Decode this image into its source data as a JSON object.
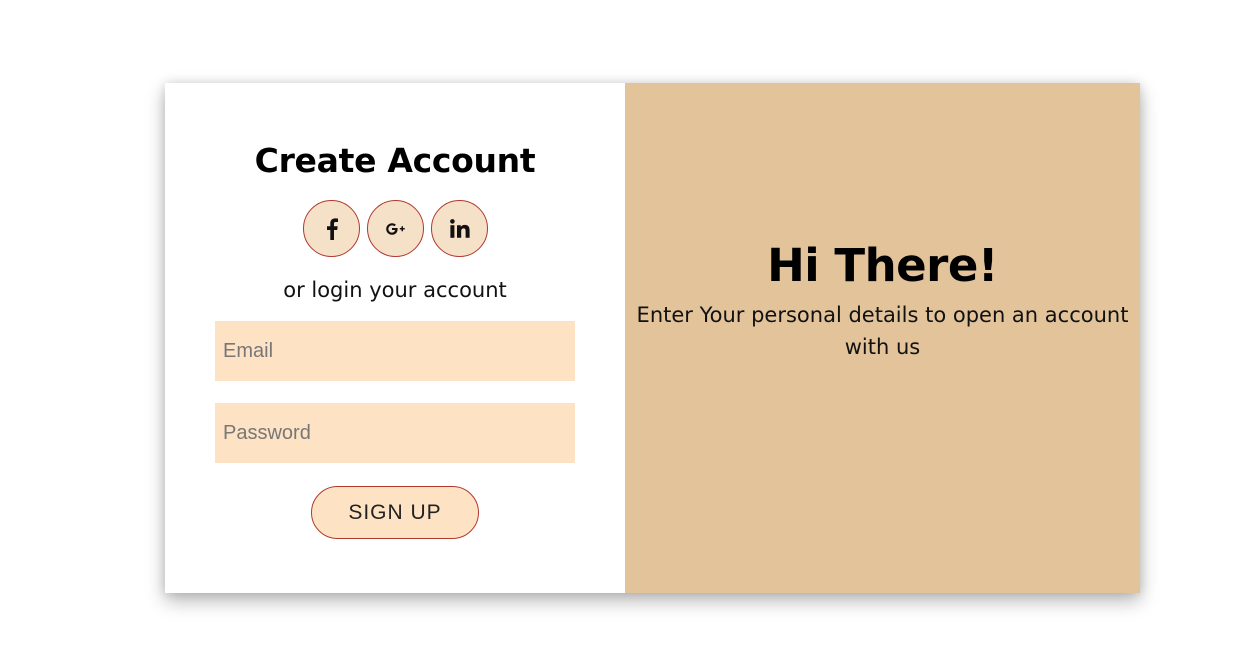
{
  "signup_panel": {
    "title": "Create Account",
    "socials": [
      {
        "icon": "facebook-icon",
        "glyph": "f"
      },
      {
        "icon": "google-plus-icon",
        "glyph": "G+"
      },
      {
        "icon": "linkedin-icon",
        "glyph": "in"
      }
    ],
    "alt_text": "or login your account",
    "email": {
      "placeholder": "Email",
      "value": ""
    },
    "password": {
      "placeholder": "Password",
      "value": ""
    },
    "submit_label": "SIGN UP"
  },
  "welcome_panel": {
    "heading": "Hi There!",
    "message": "Enter Your personal details to open an account with us"
  },
  "colors": {
    "panel_background": "#e2c39a",
    "input_background": "#fde3c4",
    "social_background": "#f5e1c8",
    "accent_border": "#b03a2e"
  }
}
